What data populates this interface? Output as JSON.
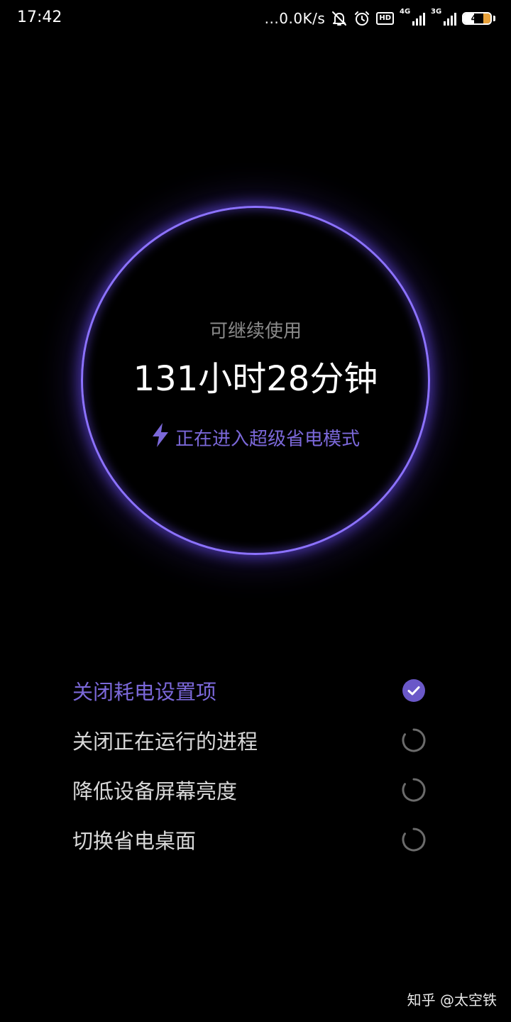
{
  "status_bar": {
    "time": "17:42",
    "network_speed": "...0.0K/s",
    "icons": [
      "mute-icon",
      "alarm-icon",
      "hd-icon",
      "signal-4g-icon",
      "signal-3g-icon",
      "battery-icon"
    ],
    "hd_label": "HD",
    "signal1_label": "4G",
    "signal2_label": "3G",
    "battery_level": "40",
    "battery_fraction": 0.4
  },
  "ring": {
    "subtitle": "可继续使用",
    "remaining_time": "131小时28分钟",
    "status_text": "正在进入超级省电模式",
    "status_icon": "lightning-icon",
    "accent_color": "#8c72ff"
  },
  "tasks": [
    {
      "label": "关闭耗电设置项",
      "state": "done",
      "icon": "check-circle-icon"
    },
    {
      "label": "关闭正在运行的进程",
      "state": "loading",
      "icon": "spinner-icon"
    },
    {
      "label": "降低设备屏幕亮度",
      "state": "loading",
      "icon": "spinner-icon"
    },
    {
      "label": "切换省电桌面",
      "state": "loading",
      "icon": "spinner-icon"
    }
  ],
  "watermark": "知乎 @太空铁",
  "colors": {
    "background": "#000000",
    "accent": "#7b68d9",
    "text_primary": "#ffffff",
    "text_secondary": "#8a8a8a",
    "battery_charge": "#e8a13a"
  }
}
